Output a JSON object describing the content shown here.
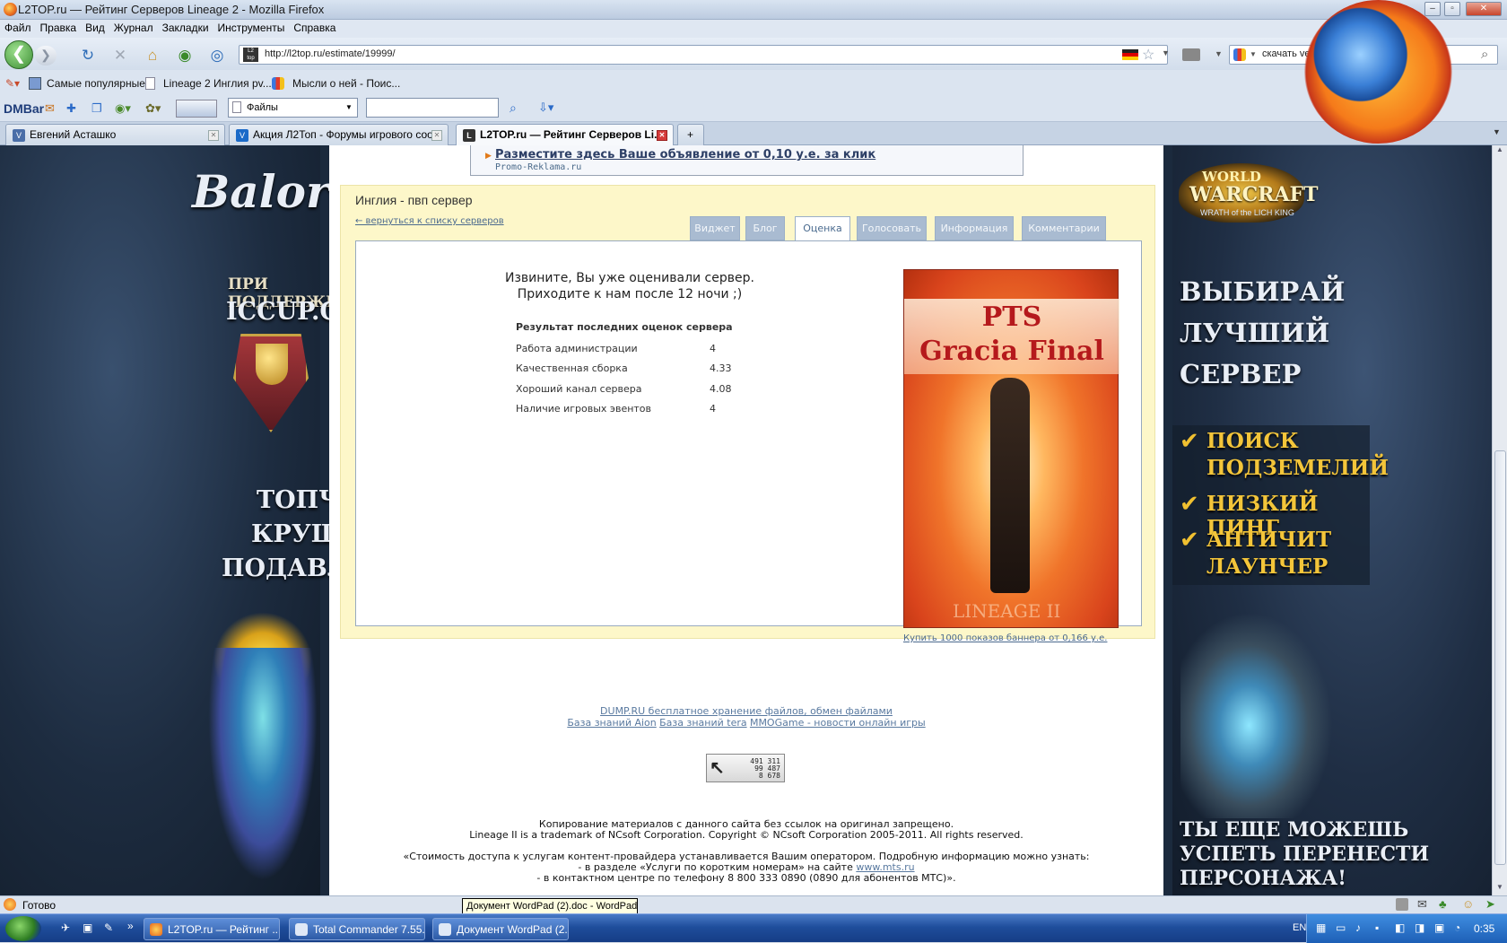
{
  "window": {
    "title": "L2TOP.ru — Рейтинг Серверов Lineage 2 - Mozilla Firefox"
  },
  "menu": [
    "Файл",
    "Правка",
    "Вид",
    "Журнал",
    "Закладки",
    "Инструменты",
    "Справка"
  ],
  "nav": {
    "url": "http://l2top.ru/estimate/19999/",
    "search_value": "скачать vertrigo"
  },
  "bookmarks": [
    "Самые популярные",
    "Lineage 2 Инглия pv...",
    "Мысли о ней - Поис..."
  ],
  "dmbar": {
    "logo": "DMBar",
    "select_value": "Файлы"
  },
  "tabs": [
    {
      "label": "Евгений Асташко",
      "icon": "V"
    },
    {
      "label": "Акция Л2Топ - Форумы игрового соо...",
      "icon": "V"
    },
    {
      "label": "L2TOP.ru — Рейтинг Серверов Li...",
      "icon": "L"
    }
  ],
  "left_banner": {
    "logo": "Balor",
    "support": "ПРИ ПОДДЕРЖКЕ",
    "iccup": "ICCUP.COM",
    "slogans": [
      "ТОПЧИ!",
      "КРУШИ!",
      "ПОДАВЛЯЙ!"
    ]
  },
  "right_banner": {
    "logo_top": "WORLD",
    "logo_main": "WARCRAFT",
    "logo_sub": "WRATH of the LICH KING",
    "headline": [
      "ВЫБИРАЙ",
      "ЛУЧШИЙ",
      "СЕРВЕР"
    ],
    "features": [
      "ПОИСК",
      "ПОДЗЕМЕЛИЙ",
      "НИЗКИЙ ПИНГ",
      "АНТИЧИТ",
      "ЛАУНЧЕР"
    ],
    "bottom": [
      "ТЫ ЕЩЕ МОЖЕШЬ",
      "УСПЕТЬ ПЕРЕНЕСТИ",
      "ПЕРСОНАЖА!"
    ]
  },
  "ad": {
    "text": "Разместите здесь Ваше объявление от 0,10 у.е. за клик",
    "source": "Promo-Reklama.ru"
  },
  "server": {
    "title": "Инглия - пвп сервер",
    "back_link": "← вернуться к списку серверов",
    "tabs": [
      "Виджет",
      "Блог",
      "Оценка",
      "Голосовать",
      "Информация",
      "Комментарии"
    ],
    "active_tab": "Оценка",
    "message_line1": "Извините, Вы уже оценивали сервер.",
    "message_line2": "Приходите к нам после 12 ночи ;)",
    "results_title": "Результат последних оценок сервера",
    "results": [
      {
        "label": "Работа администрации",
        "value": "4"
      },
      {
        "label": "Качественная сборка",
        "value": "4.33"
      },
      {
        "label": "Хороший канал сервера",
        "value": "4.08"
      },
      {
        "label": "Наличие игровых эвентов",
        "value": "4"
      }
    ],
    "banner_line1": "PTS",
    "banner_line2": "Gracia Final",
    "banner_watermark": "LINEAGE II",
    "buy_link": "Купить 1000 показов баннера от 0,166 у.е."
  },
  "footer": {
    "links_row1": [
      "DUMP.RU бесплатное хранение файлов, обмен файлами"
    ],
    "links_row2": [
      "База знаний Aion",
      "База знаний tera",
      "MMOGame - новости онлайн игры"
    ],
    "counter": [
      "491 311",
      "99 487",
      "8 678"
    ],
    "copy1": "Копирование материалов с данного сайта без ссылок на оригинал запрещено.",
    "copy2": "Lineage II is a trademark of NCsoft Corporation. Copyright © NCsoft Corporation 2005-2011. All rights reserved.",
    "legal1": "«Стоимость доступа к услугам контент-провайдера устанавливается Вашим оператором. Подробную информацию можно узнать:",
    "legal2_pre": "- в разделе «Услуги по коротким номерам» на сайте ",
    "legal2_link": "www.mts.ru",
    "legal3": "- в контактном центре по телефону 8 800 333 0890 (0890 для абонентов МТС)»."
  },
  "status": {
    "text": "Готово",
    "tooltip": "Документ WordPad (2).doc - WordPad"
  },
  "taskbar": {
    "tasks": [
      "L2TOP.ru — Рейтинг ...",
      "Total Commander 7.55...",
      "Документ WordPad (2..."
    ],
    "lang": "EN",
    "clock": "0:35"
  }
}
